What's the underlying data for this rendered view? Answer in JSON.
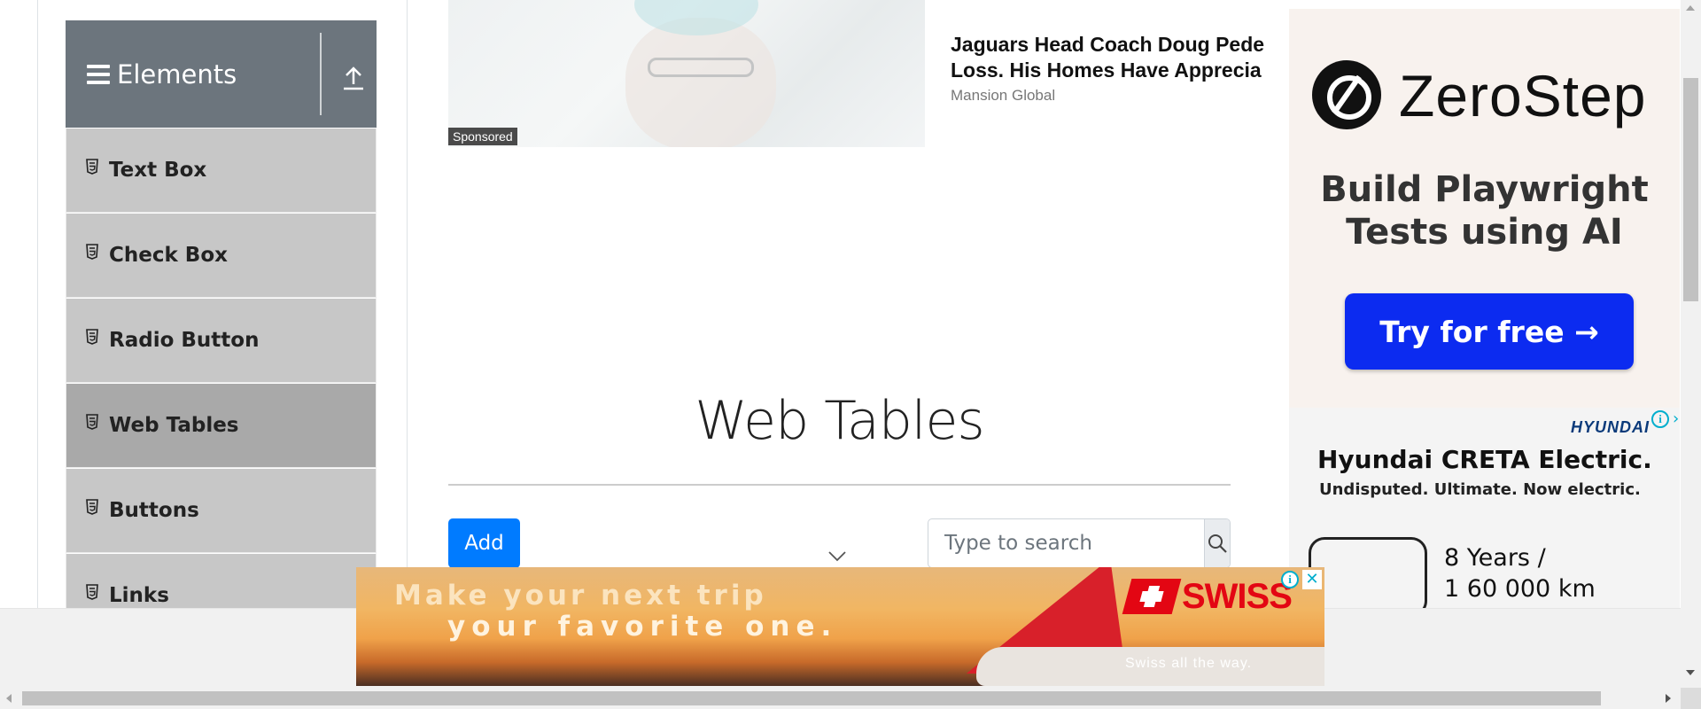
{
  "sidebar": {
    "group_title": "Elements",
    "items": [
      {
        "label": "Text Box"
      },
      {
        "label": "Check Box"
      },
      {
        "label": "Radio Button"
      },
      {
        "label": "Web Tables",
        "active": true
      },
      {
        "label": "Buttons"
      },
      {
        "label": "Links"
      }
    ]
  },
  "sponsored": {
    "badge": "Sponsored",
    "headline_line1": "Jaguars Head Coach Doug Pede",
    "headline_line2": "Loss. His Homes Have Apprecia",
    "source": "Mansion Global"
  },
  "main": {
    "title": "Web Tables",
    "add_label": "Add",
    "search_placeholder": "Type to search"
  },
  "ads": {
    "zerostep": {
      "brand": "ZeroStep",
      "tagline_line1": "Build Playwright",
      "tagline_line2": "Tests using AI",
      "cta": "Try for free →",
      "accent": "#0c2bf0"
    },
    "hyundai": {
      "brand": "HYUNDAI",
      "title": "Hyundai CRETA Electric.",
      "subtitle": "Undisputed. Ultimate. Now electric.",
      "warranty_line1": "8 Years /",
      "warranty_line2": "1 60 000 km"
    },
    "swiss": {
      "line1": "Make your next trip",
      "line2": "your favorite one.",
      "brand": "SWISS",
      "slogan": "Swiss   all   the   way.",
      "brand_color": "#e30613"
    }
  },
  "colors": {
    "sidebar_header": "#6c757d",
    "sidebar_item": "#c7c7c7",
    "sidebar_active": "#a9a9a9",
    "primary": "#007bff"
  }
}
